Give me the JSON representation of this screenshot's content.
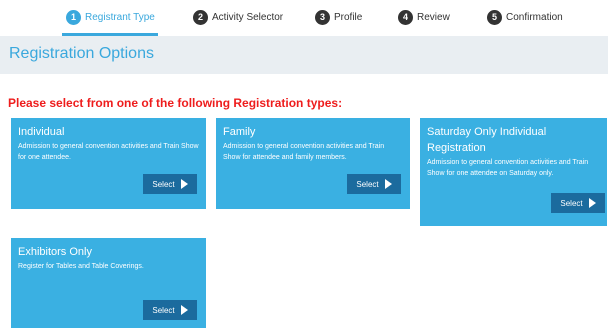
{
  "steps": [
    {
      "num": "1",
      "label": "Registrant Type",
      "active": true
    },
    {
      "num": "2",
      "label": "Activity Selector",
      "active": false
    },
    {
      "num": "3",
      "label": "Profile",
      "active": false
    },
    {
      "num": "4",
      "label": "Review",
      "active": false
    },
    {
      "num": "5",
      "label": "Confirmation",
      "active": false
    }
  ],
  "header": {
    "title": "Registration Options"
  },
  "prompt": "Please select from one of the following Registration types:",
  "cards": [
    {
      "title": "Individual",
      "description": "Admission to general convention activities and Train Show for one attendee.",
      "button": "Select"
    },
    {
      "title": "Family",
      "description": "Admission to general convention activities and Train Show for attendee and family members.",
      "button": "Select"
    },
    {
      "title": "Saturday Only Individual Registration",
      "description": "Admission to general convention activities and Train Show for one attendee on Saturday only.",
      "button": "Select"
    },
    {
      "title": "Exhibitors Only",
      "description": "Register for Tables and Table Coverings.",
      "button": "Select"
    }
  ],
  "colors": {
    "accent": "#3aa8dd",
    "card": "#3ab0e2",
    "button": "#1b6b9e",
    "prompt": "#ee1d1d",
    "header_bg": "#e9eef2"
  }
}
